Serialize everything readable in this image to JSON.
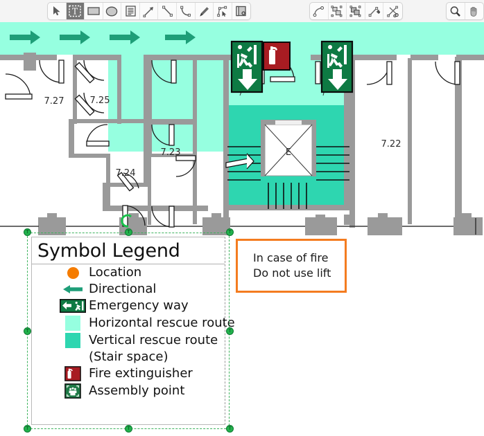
{
  "toolbar": {
    "groups": [
      {
        "name": "draw-tools",
        "buttons": [
          {
            "icon": "cursor-arrow-icon",
            "label": "Select",
            "selected": false
          },
          {
            "icon": "text-tool-icon",
            "label": "Text",
            "selected": true
          },
          {
            "icon": "rectangle-icon",
            "label": "Rectangle",
            "selected": false
          },
          {
            "icon": "ellipse-icon",
            "label": "Ellipse",
            "selected": false
          },
          {
            "icon": "text-block-icon",
            "label": "Text block",
            "selected": false
          },
          {
            "icon": "arrow-line-icon",
            "label": "Arrow",
            "selected": false
          },
          {
            "icon": "line-icon",
            "label": "Line",
            "selected": false
          },
          {
            "icon": "curve-icon",
            "label": "Curve",
            "selected": false
          },
          {
            "icon": "pen-icon",
            "label": "Pen",
            "selected": false
          },
          {
            "icon": "node-edit-icon",
            "label": "Edit nodes",
            "selected": false
          },
          {
            "icon": "image-icon",
            "label": "Image",
            "selected": false
          }
        ]
      },
      {
        "name": "path-tools",
        "buttons": [
          {
            "icon": "bezier-path-icon",
            "label": "Bezier path",
            "selected": false
          },
          {
            "icon": "group-objects-icon",
            "label": "Group",
            "selected": false
          },
          {
            "icon": "ungroup-objects-icon",
            "label": "Ungroup",
            "selected": false
          },
          {
            "icon": "add-node-icon",
            "label": "Add node",
            "selected": false
          },
          {
            "icon": "split-path-icon",
            "label": "Split path",
            "selected": false
          }
        ]
      },
      {
        "name": "view-tools",
        "buttons": [
          {
            "icon": "magnifier-icon",
            "label": "Zoom",
            "selected": false
          },
          {
            "icon": "hand-pan-icon",
            "label": "Pan",
            "selected": false
          }
        ]
      }
    ]
  },
  "plan": {
    "room_labels": [
      "7.27",
      "7.25",
      "7.23",
      "7.24",
      "7.22"
    ],
    "elevator_letter": "E",
    "signs": [
      {
        "name": "emergency-exit-down-sign-left",
        "type": "exit-down"
      },
      {
        "name": "fire-extinguisher-sign",
        "type": "fire-extinguisher"
      },
      {
        "name": "emergency-exit-down-sign-right",
        "type": "exit-down"
      }
    ],
    "direction_arrows": 4,
    "colors": {
      "horizontal_rescue_route": "#96FFE0",
      "vertical_rescue_route": "#2ED6B0",
      "directional_arrow": "#1E9E78",
      "wall": "#9A9A9A",
      "sign_green": "#0E7A43",
      "sign_red": "#A81C22",
      "location_orange": "#F57C00"
    }
  },
  "legend": {
    "title": "Symbol Legend",
    "items": [
      {
        "swatch": "location-dot-icon",
        "label": "Location"
      },
      {
        "swatch": "directional-arrow-icon",
        "label": "Directional"
      },
      {
        "swatch": "emergency-way-sign-icon",
        "label": "Emergency way"
      },
      {
        "swatch": "horizontal-route-swatch",
        "label": "Horizontal rescue route"
      },
      {
        "swatch": "vertical-route-swatch",
        "label": "Vertical rescue route"
      },
      {
        "swatch": "",
        "label": "(Stair space)"
      },
      {
        "swatch": "fire-extinguisher-icon",
        "label": "Fire extinguisher"
      },
      {
        "swatch": "assembly-point-icon",
        "label": "Assembly point"
      }
    ]
  },
  "note": {
    "line1": "In case of fire",
    "line2": "Do not use lift",
    "border_color": "#F47C20"
  }
}
